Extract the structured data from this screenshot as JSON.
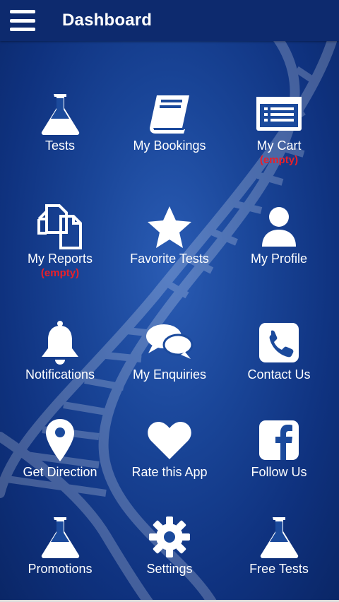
{
  "header": {
    "title": "Dashboard",
    "menu_icon": "hamburger-menu-icon"
  },
  "colors": {
    "header_bg": "#0d2a6e",
    "background": "#1a4699",
    "badge": "#e8202a",
    "icon": "#ffffff"
  },
  "tiles": [
    {
      "label": "Tests",
      "icon": "flask-icon",
      "badge": ""
    },
    {
      "label": "My Bookings",
      "icon": "book-icon",
      "badge": ""
    },
    {
      "label": "My Cart",
      "icon": "cart-list-icon",
      "badge": "(empty)"
    },
    {
      "label": "My Reports",
      "icon": "copy-documents-icon",
      "badge": "(empty)"
    },
    {
      "label": "Favorite Tests",
      "icon": "star-icon",
      "badge": ""
    },
    {
      "label": "My Profile",
      "icon": "user-icon",
      "badge": ""
    },
    {
      "label": "Notifications",
      "icon": "bell-icon",
      "badge": ""
    },
    {
      "label": "My Enquiries",
      "icon": "chat-bubbles-icon",
      "badge": ""
    },
    {
      "label": "Contact Us",
      "icon": "phone-icon",
      "badge": ""
    },
    {
      "label": "Get Direction",
      "icon": "map-pin-icon",
      "badge": ""
    },
    {
      "label": "Rate this App",
      "icon": "heart-icon",
      "badge": ""
    },
    {
      "label": "Follow Us",
      "icon": "facebook-icon",
      "badge": ""
    },
    {
      "label": "Promotions",
      "icon": "flask-icon",
      "badge": ""
    },
    {
      "label": "Settings",
      "icon": "gear-icon",
      "badge": ""
    },
    {
      "label": "Free Tests",
      "icon": "flask-icon",
      "badge": ""
    }
  ]
}
